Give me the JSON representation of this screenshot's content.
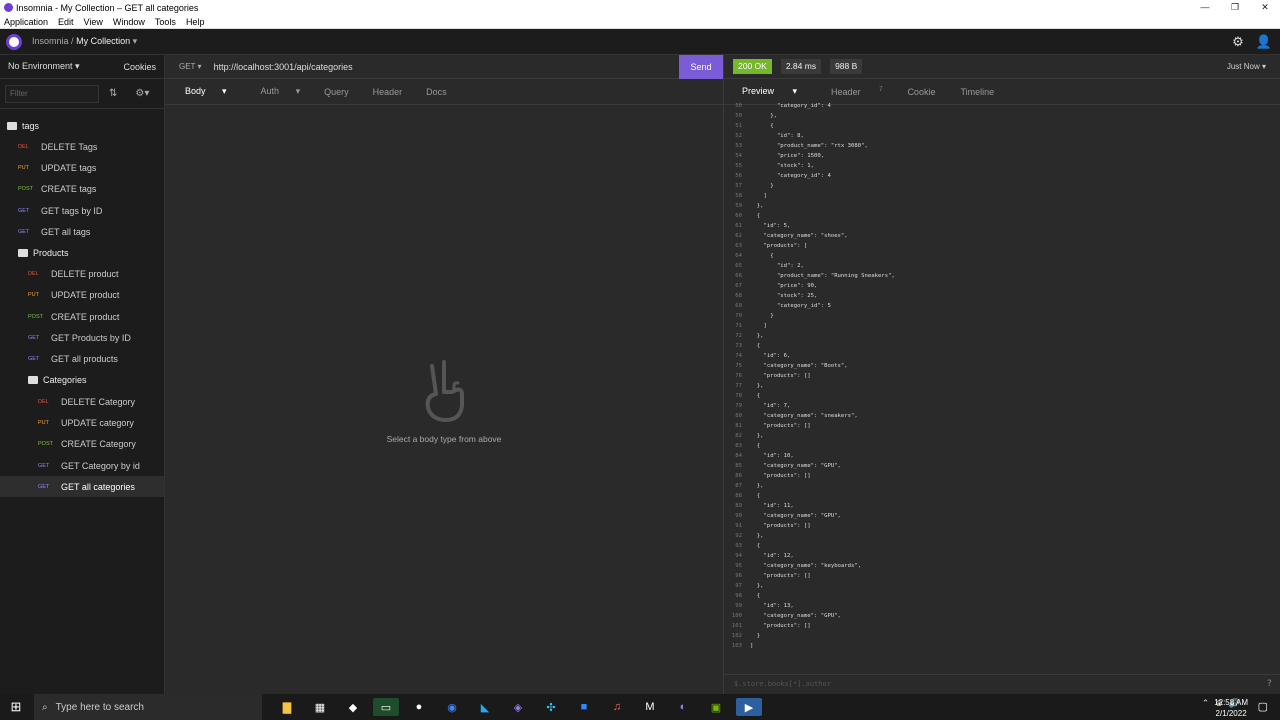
{
  "window": {
    "title": "Insomnia - My Collection – GET all categories"
  },
  "menu": [
    "Application",
    "Edit",
    "View",
    "Window",
    "Tools",
    "Help"
  ],
  "header": {
    "app": "Insomnia",
    "separator": "/",
    "collection": "My Collection"
  },
  "sidebar": {
    "environment": "No Environment",
    "cookies": "Cookies",
    "filter_placeholder": "Filter",
    "groups": [
      {
        "name": "tags",
        "items": [
          {
            "method": "DEL",
            "label": "DELETE Tags"
          },
          {
            "method": "PUT",
            "label": "UPDATE tags"
          },
          {
            "method": "POST",
            "label": "CREATE tags"
          },
          {
            "method": "GET",
            "label": "GET tags by ID"
          },
          {
            "method": "GET",
            "label": "GET all tags"
          }
        ]
      },
      {
        "name": "Products",
        "items": [
          {
            "method": "DEL",
            "label": "DELETE product"
          },
          {
            "method": "PUT",
            "label": "UPDATE product"
          },
          {
            "method": "POST",
            "label": "CREATE product"
          },
          {
            "method": "GET",
            "label": "GET Products by ID"
          },
          {
            "method": "GET",
            "label": "GET all products"
          }
        ]
      },
      {
        "name": "Categories",
        "items": [
          {
            "method": "DEL",
            "label": "DELETE Category"
          },
          {
            "method": "PUT",
            "label": "UPDATE category"
          },
          {
            "method": "POST",
            "label": "CREATE Category"
          },
          {
            "method": "GET",
            "label": "GET Category by id"
          },
          {
            "method": "GET",
            "label": "GET all categories"
          }
        ]
      }
    ]
  },
  "request": {
    "method": "GET",
    "url": "http://localhost:3001/api/categories",
    "send": "Send",
    "tabs": [
      "Body",
      "Auth",
      "Query",
      "Header",
      "Docs"
    ],
    "empty_text": "Select a body type from above"
  },
  "response": {
    "status": "200 OK",
    "time": "2.84 ms",
    "size": "988 B",
    "when": "Just Now",
    "tabs": [
      "Preview",
      "Header",
      "Cookie",
      "Timeline"
    ],
    "header_count": "7",
    "filter_placeholder": "$.store.books[*].author",
    "lines": [
      [
        50,
        "        \"category_id\": 4"
      ],
      [
        50,
        "      },"
      ],
      [
        51,
        "      {"
      ],
      [
        52,
        "        \"id\": 8,"
      ],
      [
        53,
        "        \"product_name\": \"rtx 3080\","
      ],
      [
        54,
        "        \"price\": 1500,"
      ],
      [
        55,
        "        \"stock\": 1,"
      ],
      [
        56,
        "        \"category_id\": 4"
      ],
      [
        57,
        "      }"
      ],
      [
        58,
        "    ]"
      ],
      [
        59,
        "  },"
      ],
      [
        60,
        "  {"
      ],
      [
        61,
        "    \"id\": 5,"
      ],
      [
        62,
        "    \"category_name\": \"shoes\","
      ],
      [
        63,
        "    \"products\": ["
      ],
      [
        64,
        "      {"
      ],
      [
        65,
        "        \"id\": 2,"
      ],
      [
        66,
        "        \"product_name\": \"Running Sneakers\","
      ],
      [
        67,
        "        \"price\": 90,"
      ],
      [
        68,
        "        \"stock\": 25,"
      ],
      [
        69,
        "        \"category_id\": 5"
      ],
      [
        70,
        "      }"
      ],
      [
        71,
        "    ]"
      ],
      [
        72,
        "  },"
      ],
      [
        73,
        "  {"
      ],
      [
        74,
        "    \"id\": 6,"
      ],
      [
        75,
        "    \"category_name\": \"Boots\","
      ],
      [
        76,
        "    \"products\": []"
      ],
      [
        77,
        "  },"
      ],
      [
        78,
        "  {"
      ],
      [
        79,
        "    \"id\": 7,"
      ],
      [
        80,
        "    \"category_name\": \"sneakers\","
      ],
      [
        81,
        "    \"products\": []"
      ],
      [
        82,
        "  },"
      ],
      [
        83,
        "  {"
      ],
      [
        84,
        "    \"id\": 10,"
      ],
      [
        85,
        "    \"category_name\": \"GPU\","
      ],
      [
        86,
        "    \"products\": []"
      ],
      [
        87,
        "  },"
      ],
      [
        88,
        "  {"
      ],
      [
        89,
        "    \"id\": 11,"
      ],
      [
        90,
        "    \"category_name\": \"GPU\","
      ],
      [
        91,
        "    \"products\": []"
      ],
      [
        92,
        "  },"
      ],
      [
        93,
        "  {"
      ],
      [
        94,
        "    \"id\": 12,"
      ],
      [
        95,
        "    \"category_name\": \"keyboards\","
      ],
      [
        96,
        "    \"products\": []"
      ],
      [
        97,
        "  },"
      ],
      [
        98,
        "  {"
      ],
      [
        99,
        "    \"id\": 13,"
      ],
      [
        100,
        "    \"category_name\": \"GPU\","
      ],
      [
        101,
        "    \"products\": []"
      ],
      [
        102,
        "  }"
      ],
      [
        103,
        "]"
      ]
    ]
  },
  "taskbar": {
    "search_placeholder": "Type here to search",
    "time": "12:58 AM",
    "date": "2/1/2022"
  },
  "colors": {
    "accent": "#7a5cd6",
    "ok": "#75b72d",
    "del": "#e5533d",
    "put": "#f0a030",
    "post": "#7cc242",
    "get": "#8a8aff"
  }
}
